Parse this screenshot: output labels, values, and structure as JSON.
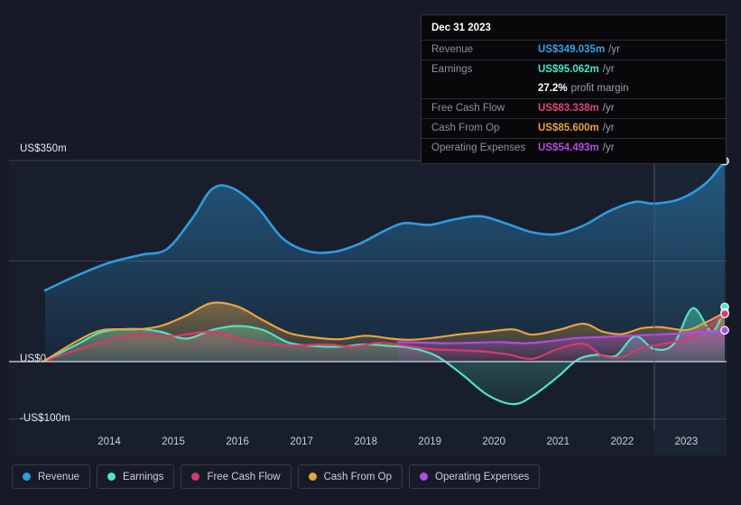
{
  "tooltip": {
    "date": "Dec 31 2023",
    "rows": [
      {
        "key": "Revenue",
        "value": "US$349.035m",
        "unit": "/yr",
        "color": "#3aa0e8"
      },
      {
        "key": "Earnings",
        "value": "US$95.062m",
        "unit": "/yr",
        "color": "#4fe3c2"
      },
      {
        "key": "",
        "value": "27.2%",
        "unit": "profit margin",
        "color": "#ffffff"
      },
      {
        "key": "Free Cash Flow",
        "value": "US$83.338m",
        "unit": "/yr",
        "color": "#e0457b"
      },
      {
        "key": "Cash From Op",
        "value": "US$85.600m",
        "unit": "/yr",
        "color": "#e8a33d"
      },
      {
        "key": "Operating Expenses",
        "value": "US$54.493m",
        "unit": "/yr",
        "color": "#b44ae0"
      }
    ]
  },
  "legend": {
    "items": [
      {
        "label": "Revenue",
        "color": "#2e9ce0"
      },
      {
        "label": "Earnings",
        "color": "#4fe3c2"
      },
      {
        "label": "Free Cash Flow",
        "color": "#d6396e"
      },
      {
        "label": "Cash From Op",
        "color": "#e8a33d"
      },
      {
        "label": "Operating Expenses",
        "color": "#b44ae0"
      }
    ]
  },
  "axes": {
    "y_top_label": "US$350m",
    "y_zero_label": "US$0",
    "y_bottom_label": "-US$100m",
    "x_ticks": [
      "2014",
      "2015",
      "2016",
      "2017",
      "2018",
      "2019",
      "2020",
      "2021",
      "2022",
      "2023"
    ]
  },
  "chart_data": {
    "type": "area",
    "title": "",
    "xlabel": "",
    "ylabel": "US$ millions",
    "ylim": [
      -100,
      350
    ],
    "xlim": [
      2013.5,
      2024.1
    ],
    "grid": true,
    "legend_position": "bottom",
    "y_gridlines": [
      350,
      175,
      0,
      -100
    ],
    "forecast_divider_x": 2023.0,
    "units": "US$m per year",
    "series": [
      {
        "name": "Revenue",
        "color": "#2e9ce0",
        "x": [
          2013.5,
          2014.0,
          2014.5,
          2015.0,
          2015.4,
          2015.8,
          2016.1,
          2016.4,
          2016.8,
          2017.2,
          2017.6,
          2018.0,
          2018.4,
          2018.8,
          2019.1,
          2019.5,
          2019.9,
          2020.3,
          2020.7,
          2021.1,
          2021.5,
          2021.9,
          2022.3,
          2022.7,
          2023.0,
          2023.4,
          2023.8,
          2024.1
        ],
        "values": [
          124.0,
          150.0,
          172.0,
          186.0,
          196.0,
          250.0,
          300.0,
          303.0,
          270.0,
          215.0,
          192.0,
          191.0,
          205.0,
          228.0,
          241.0,
          238.0,
          248.0,
          253.0,
          240.0,
          225.0,
          222.0,
          237.0,
          262.0,
          278.0,
          275.0,
          283.0,
          310.0,
          349.0
        ]
      },
      {
        "name": "Earnings",
        "color": "#4fe3c2",
        "x": [
          2013.5,
          2014.0,
          2014.4,
          2014.9,
          2015.3,
          2015.7,
          2016.1,
          2016.5,
          2016.9,
          2017.3,
          2017.7,
          2018.1,
          2018.5,
          2018.9,
          2019.2,
          2019.6,
          2020.0,
          2020.4,
          2020.8,
          2021.1,
          2021.5,
          2021.8,
          2022.1,
          2022.4,
          2022.7,
          2023.0,
          2023.3,
          2023.6,
          2023.9,
          2024.1
        ],
        "values": [
          2.0,
          30.0,
          52.0,
          57.0,
          52.0,
          40.0,
          55.0,
          62.0,
          55.0,
          33.0,
          27.0,
          26.0,
          30.0,
          27.0,
          24.0,
          10.0,
          -22.0,
          -58.0,
          -74.0,
          -60.0,
          -26.0,
          3.0,
          12.0,
          10.0,
          44.0,
          22.0,
          30.0,
          93.0,
          52.0,
          95.0
        ]
      },
      {
        "name": "Free Cash Flow",
        "color": "#d6396e",
        "x": [
          2013.5,
          2014.2,
          2014.9,
          2015.5,
          2016.1,
          2016.7,
          2017.3,
          2017.9,
          2018.3,
          2018.7,
          2019.1,
          2019.5,
          2019.9,
          2020.3,
          2020.7,
          2021.1,
          2021.5,
          2021.9,
          2022.2,
          2022.5,
          2022.8,
          2023.1,
          2023.5,
          2023.8,
          2024.1
        ],
        "values": [
          1.0,
          28.0,
          47.0,
          45.0,
          52.0,
          36.0,
          28.0,
          30.0,
          26.0,
          33.0,
          28.0,
          22.0,
          20.0,
          18.0,
          13.0,
          5.0,
          22.0,
          31.0,
          10.0,
          8.0,
          24.0,
          30.0,
          40.0,
          58.0,
          83.3
        ]
      },
      {
        "name": "Cash From Op",
        "color": "#e8a33d",
        "x": [
          2013.5,
          2014.0,
          2014.4,
          2014.9,
          2015.3,
          2015.7,
          2016.1,
          2016.5,
          2016.9,
          2017.3,
          2017.7,
          2018.1,
          2018.5,
          2018.9,
          2019.2,
          2019.6,
          2020.0,
          2020.4,
          2020.8,
          2021.1,
          2021.5,
          2021.9,
          2022.2,
          2022.5,
          2022.8,
          2023.1,
          2023.5,
          2023.8,
          2024.1
        ],
        "values": [
          2.0,
          36.0,
          55.0,
          56.0,
          62.0,
          80.0,
          102.0,
          96.0,
          72.0,
          50.0,
          42.0,
          39.0,
          45.0,
          40.0,
          38.0,
          42.0,
          48.0,
          52.0,
          56.0,
          47.0,
          55.0,
          66.0,
          52.0,
          48.0,
          58.0,
          60.0,
          55.0,
          68.0,
          85.6
        ]
      },
      {
        "name": "Operating Expenses",
        "color": "#b44ae0",
        "x": [
          2019.0,
          2019.4,
          2019.8,
          2020.2,
          2020.6,
          2021.0,
          2021.4,
          2021.8,
          2022.2,
          2022.6,
          2023.0,
          2023.4,
          2023.8,
          2024.1
        ],
        "values": [
          34.0,
          33.0,
          32.0,
          33.0,
          34.0,
          32.0,
          36.0,
          41.0,
          43.0,
          45.0,
          47.0,
          49.0,
          52.0,
          54.5
        ]
      }
    ],
    "end_markers": [
      {
        "name": "Revenue",
        "value": 349.035,
        "color": "#2e9ce0"
      },
      {
        "name": "Earnings",
        "value": 95.062,
        "color": "#4fe3c2"
      },
      {
        "name": "Cash From Op",
        "value": 85.6,
        "color": "#e8a33d"
      },
      {
        "name": "Free Cash Flow",
        "value": 83.338,
        "color": "#d6396e"
      },
      {
        "name": "Operating Expenses",
        "value": 54.493,
        "color": "#b44ae0"
      }
    ]
  }
}
